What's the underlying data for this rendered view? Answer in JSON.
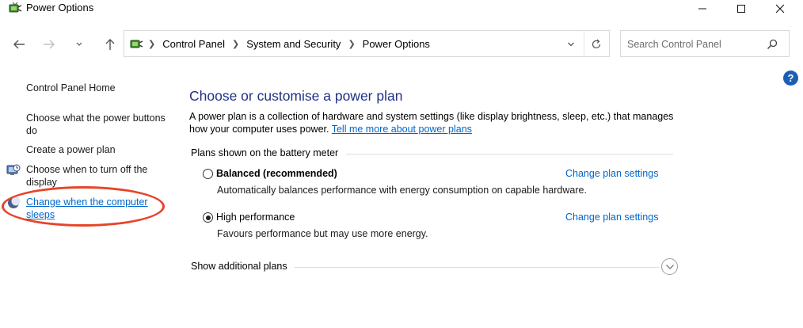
{
  "window": {
    "title": "Power Options",
    "controls": [
      "minimize-icon",
      "maximize-icon",
      "close-icon"
    ]
  },
  "nav": {
    "address": {
      "crumbs": [
        "Control Panel",
        "System and Security",
        "Power Options"
      ]
    },
    "search": {
      "placeholder": "Search Control Panel"
    }
  },
  "help": {
    "label": "?"
  },
  "sidebar": {
    "home": "Control Panel Home",
    "items": [
      {
        "label": "Choose what the power buttons do",
        "icon": null
      },
      {
        "label": "Create a power plan",
        "icon": null
      },
      {
        "label": "Choose when to turn off the display",
        "icon": "monitor-clock-icon"
      },
      {
        "label": "Change when the computer sleeps",
        "icon": "moon-icon",
        "highlighted": true
      }
    ]
  },
  "main": {
    "title": "Choose or customise a power plan",
    "description": "A power plan is a collection of hardware and system settings (like display brightness, sleep, etc.) that manages how your computer uses power.",
    "description_link": "Tell me more about power plans",
    "plans_section_label": "Plans shown on the battery meter",
    "plans": [
      {
        "name": "Balanced (recommended)",
        "selected": false,
        "settings_link": "Change plan settings",
        "description": "Automatically balances performance with energy consumption on capable hardware."
      },
      {
        "name": "High performance",
        "selected": true,
        "settings_link": "Change plan settings",
        "description": "Favours performance but may use more energy."
      }
    ],
    "additional_plans_label": "Show additional plans"
  },
  "colors": {
    "title": "#1e3287",
    "link": "#0066cc",
    "annotation": "#e6452a"
  }
}
